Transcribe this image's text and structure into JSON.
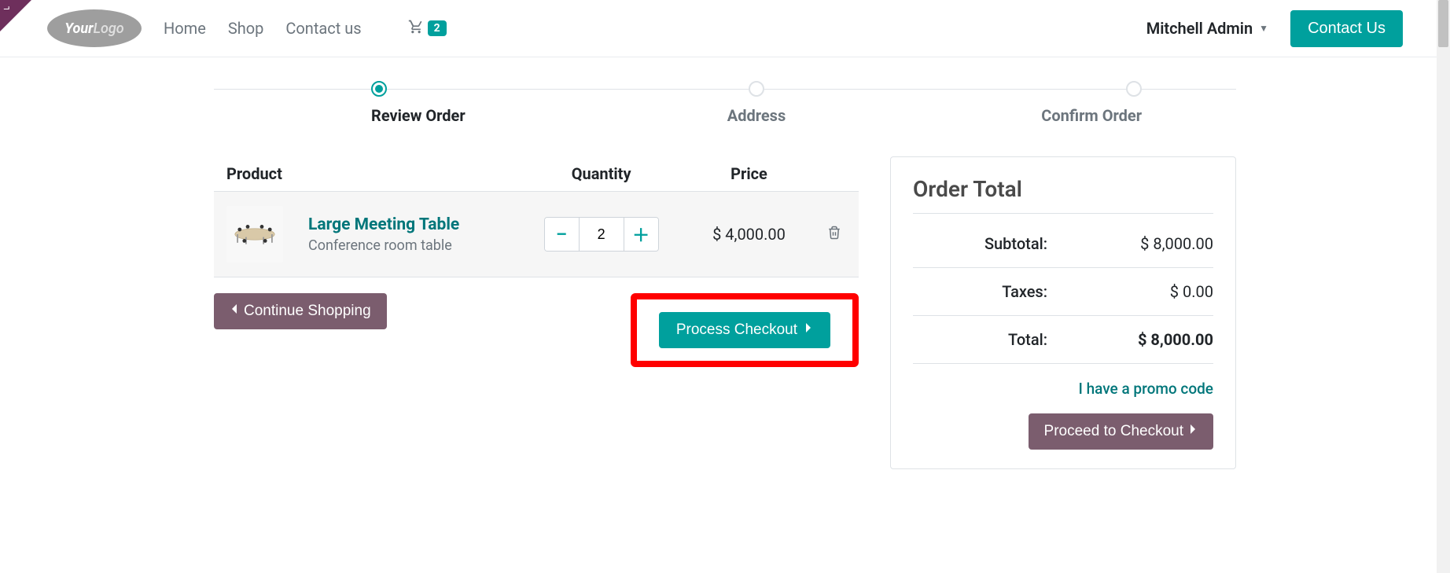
{
  "nav": {
    "home": "Home",
    "shop": "Shop",
    "contact": "Contact us",
    "cart_count": "2",
    "user": "Mitchell Admin",
    "contact_btn": "Contact Us"
  },
  "logo": {
    "your": "Your",
    "logo": "Logo"
  },
  "steps": {
    "review": "Review Order",
    "address": "Address",
    "confirm": "Confirm Order"
  },
  "table": {
    "h_product": "Product",
    "h_qty": "Quantity",
    "h_price": "Price"
  },
  "cart": {
    "items": [
      {
        "name": "Large Meeting Table",
        "desc": "Conference room table",
        "qty": "2",
        "price": "$ 4,000.00"
      }
    ]
  },
  "actions": {
    "continue_shopping": "Continue Shopping",
    "process_checkout": "Process Checkout"
  },
  "summary": {
    "title": "Order Total",
    "subtotal_label": "Subtotal:",
    "subtotal_val": "$ 8,000.00",
    "taxes_label": "Taxes:",
    "taxes_val": "$ 0.00",
    "total_label": "Total:",
    "total_val": "$ 8,000.00",
    "promo": "I have a promo code",
    "proceed": "Proceed to Checkout"
  }
}
